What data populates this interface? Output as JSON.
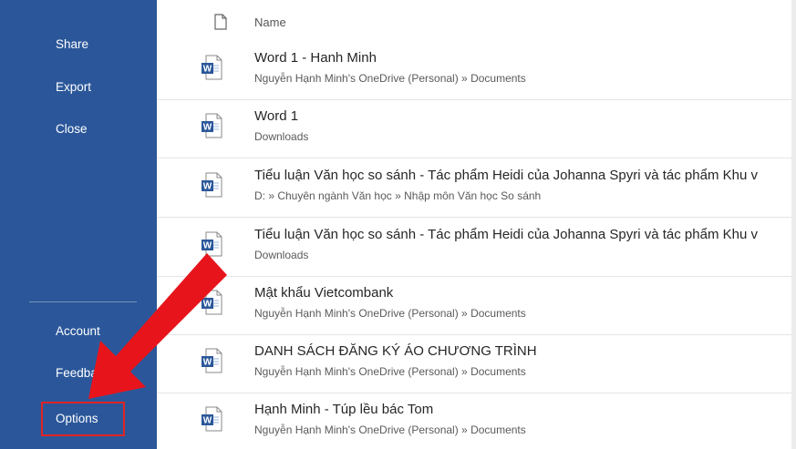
{
  "sidebar": {
    "top_items": [
      {
        "label": "Share"
      },
      {
        "label": "Export"
      },
      {
        "label": "Close"
      }
    ],
    "bottom_items": [
      {
        "label": "Account"
      },
      {
        "label": "Feedback"
      },
      {
        "label": "Options"
      }
    ],
    "background": "#2b579a"
  },
  "list": {
    "header": {
      "label": "Name",
      "icon": "file-icon"
    },
    "files": [
      {
        "name": "Word 1 - Hanh Minh",
        "path": "Nguyễn Hạnh Minh's OneDrive (Personal) » Documents",
        "icon": "word-doc-icon"
      },
      {
        "name": "Word 1",
        "path": "Downloads",
        "icon": "word-doc-icon"
      },
      {
        "name": "Tiểu luận Văn học so sánh - Tác phẩm Heidi của Johanna Spyri và tác phẩm Khu v",
        "path": "D: » Chuyên ngành Văn học » Nhập môn Văn học So sánh",
        "icon": "word-doc-icon"
      },
      {
        "name": "Tiểu luận Văn học so sánh - Tác phẩm Heidi của Johanna Spyri và tác phẩm Khu v",
        "path": "Downloads",
        "icon": "word-doc-icon"
      },
      {
        "name": "Mật khẩu Vietcombank",
        "path": "Nguyễn Hạnh Minh's OneDrive (Personal) » Documents",
        "icon": "word-doc-icon"
      },
      {
        "name": "DANH SÁCH ĐĂNG KÝ ÁO CHƯƠNG TRÌNH",
        "path": "Nguyễn Hạnh Minh's OneDrive (Personal) » Documents",
        "icon": "word-doc-icon"
      },
      {
        "name": "Hạnh Minh - Túp lều bác Tom",
        "path": "Nguyễn Hạnh Minh's OneDrive (Personal) » Documents",
        "icon": "word-doc-icon"
      }
    ]
  },
  "annotation": {
    "arrow_color": "#e8141b",
    "highlight_color": "#e02424"
  }
}
